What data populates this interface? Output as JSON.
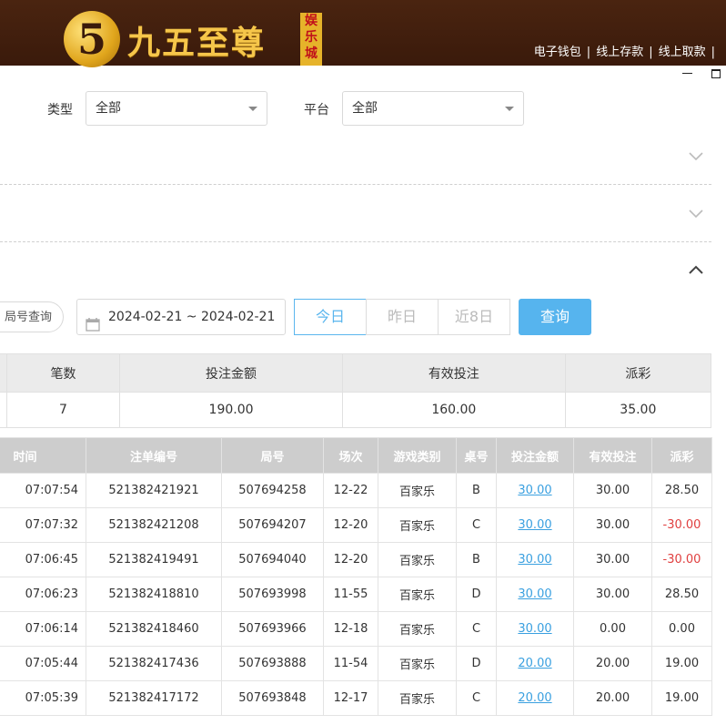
{
  "brand": {
    "logo_num": "5",
    "name": "九五至尊",
    "badge": "娱乐城"
  },
  "top_links": [
    "电子钱包",
    "线上存款",
    "线上取款"
  ],
  "filters": {
    "type_label": "类型",
    "type_value": "全部",
    "platform_label": "平台",
    "platform_value": "全部"
  },
  "query": {
    "round_search": "局号查询",
    "date_range": "2024-02-21 ~ 2024-02-21",
    "today": "今日",
    "yesterday": "昨日",
    "last8": "近8日",
    "search": "查询"
  },
  "summary": {
    "headers": [
      "",
      "笔数",
      "投注金额",
      "有效投注",
      "派彩"
    ],
    "values": [
      "",
      "7",
      "190.00",
      "160.00",
      "35.00"
    ]
  },
  "details": {
    "headers": [
      "时间",
      "注单编号",
      "局号",
      "场次",
      "游戏类别",
      "桌号",
      "投注金额",
      "有效投注",
      "派彩"
    ],
    "rows": [
      [
        "07:07:54",
        "521382421921",
        "507694258",
        "12-22",
        "百家乐",
        "B",
        "30.00",
        "30.00",
        "28.50"
      ],
      [
        "07:07:32",
        "521382421208",
        "507694207",
        "12-20",
        "百家乐",
        "C",
        "30.00",
        "30.00",
        "-30.00"
      ],
      [
        "07:06:45",
        "521382419491",
        "507694040",
        "12-20",
        "百家乐",
        "B",
        "30.00",
        "30.00",
        "-30.00"
      ],
      [
        "07:06:23",
        "521382418810",
        "507693998",
        "11-55",
        "百家乐",
        "D",
        "30.00",
        "30.00",
        "28.50"
      ],
      [
        "07:06:14",
        "521382418460",
        "507693966",
        "12-18",
        "百家乐",
        "C",
        "30.00",
        "0.00",
        "0.00"
      ],
      [
        "07:05:44",
        "521382417436",
        "507693888",
        "11-54",
        "百家乐",
        "D",
        "20.00",
        "20.00",
        "19.00"
      ],
      [
        "07:05:39",
        "521382417172",
        "507693848",
        "12-17",
        "百家乐",
        "C",
        "20.00",
        "20.00",
        "19.00"
      ]
    ]
  },
  "colors": {
    "accent": "#56b4ee",
    "negative": "#e04040",
    "link": "#3aa0e0",
    "header_bg": "#4a2410"
  }
}
